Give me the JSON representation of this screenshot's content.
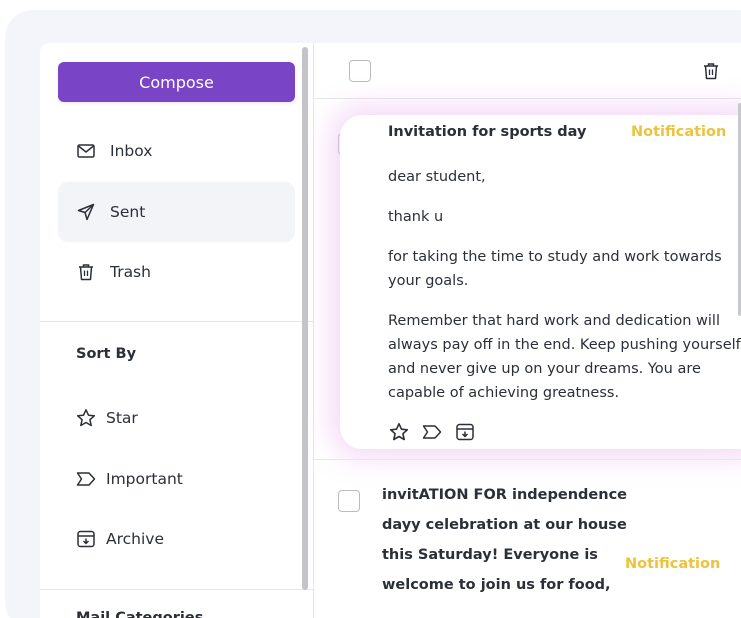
{
  "sidebar": {
    "compose_label": "Compose",
    "nav": [
      {
        "label": "Inbox",
        "icon": "mail-icon"
      },
      {
        "label": "Sent",
        "icon": "send-icon",
        "active": true
      },
      {
        "label": "Trash",
        "icon": "trash-icon"
      }
    ],
    "sort_title": "Sort By",
    "sort_items": [
      {
        "label": "Star",
        "icon": "star-icon"
      },
      {
        "label": "Important",
        "icon": "label-icon"
      },
      {
        "label": "Archive",
        "icon": "archive-icon"
      }
    ],
    "mail_categories_title": "Mail Categories"
  },
  "mails": [
    {
      "subject": "Invitation for sports day",
      "badge": "Notification",
      "body": [
        "dear student,",
        "thank u",
        "for taking the time to study and work towards your goals.",
        "Remember that hard work and dedication will always pay off in the end. Keep pushing yourself and never give up on your dreams. You are capable of achieving greatness."
      ]
    },
    {
      "subject": "invitATION FOR independence dayy celebration at our house this Saturday! Everyone is welcome to join us for food,",
      "badge": "Notification"
    }
  ],
  "colors": {
    "accent": "#7a44c7",
    "badge": "#ecc33c",
    "highlight_glow": "#e296e8",
    "active_nav_bg": "#f2f4f8"
  }
}
